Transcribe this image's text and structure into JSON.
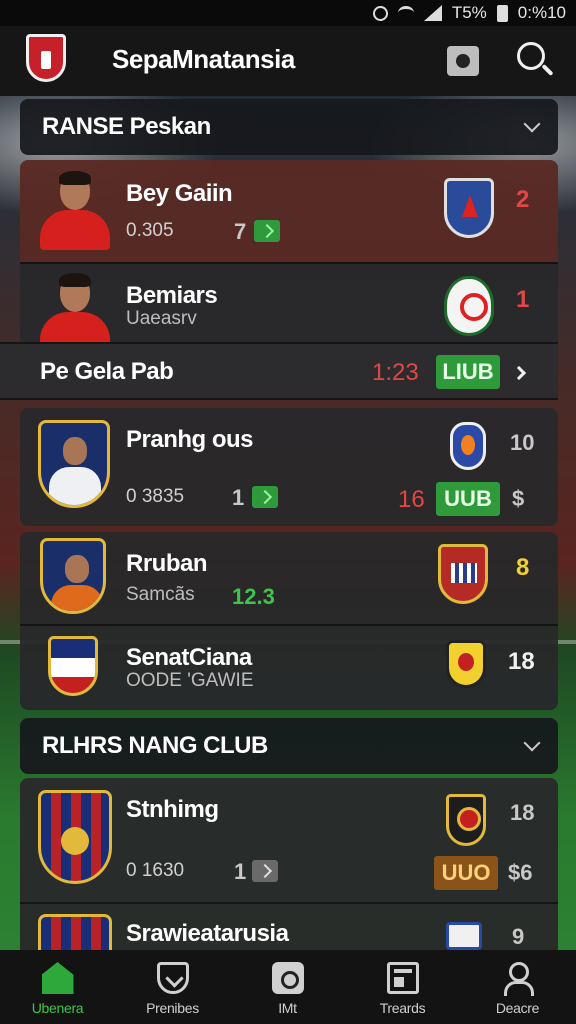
{
  "status_bar": {
    "battery": "T5%",
    "time": "0:%10"
  },
  "app": {
    "title": "SepaMnatansia"
  },
  "sections": {
    "first": {
      "title": "RANSE Peskan"
    },
    "second": {
      "title": "RLHRS NANG CLUB"
    }
  },
  "players": [
    {
      "name": "Bey Gaiin",
      "value": "0.305",
      "rank": "7",
      "score": "2"
    },
    {
      "name": "Bemiars",
      "sub": "Uaeasrv",
      "score": "1"
    },
    {
      "name": "Pranhg ous",
      "value": "0 3835",
      "rank": "1",
      "score": "10",
      "trend_num": "16",
      "badge": "UUB",
      "mark": "$"
    },
    {
      "name": "Rruban",
      "sub": "Samcãs",
      "delta": "12.3",
      "score": "8"
    },
    {
      "name": "SenatCiana",
      "sub": "OODE 'GAWIE",
      "score": "18"
    }
  ],
  "match": {
    "label": "Pe Gela Pab",
    "time": "1:23",
    "badge": "LIUB"
  },
  "club_rows": [
    {
      "name": "Stnhimg",
      "value": "0 1630",
      "rank": "1",
      "score": "18",
      "badge": "UUO",
      "score2": "$6"
    },
    {
      "name": "Srawieatarusia",
      "score": "9"
    }
  ],
  "nav": [
    {
      "label": "Ubenera",
      "icon": "home-icon"
    },
    {
      "label": "Prenibes",
      "icon": "shield-icon"
    },
    {
      "label": "IMt",
      "icon": "ball-icon"
    },
    {
      "label": "Treards",
      "icon": "board-icon"
    },
    {
      "label": "Deacre",
      "icon": "person-icon"
    }
  ],
  "colors": {
    "accent_green": "#3fc44b",
    "highlight_red": "#e04848",
    "card_bg": "#28282a"
  }
}
